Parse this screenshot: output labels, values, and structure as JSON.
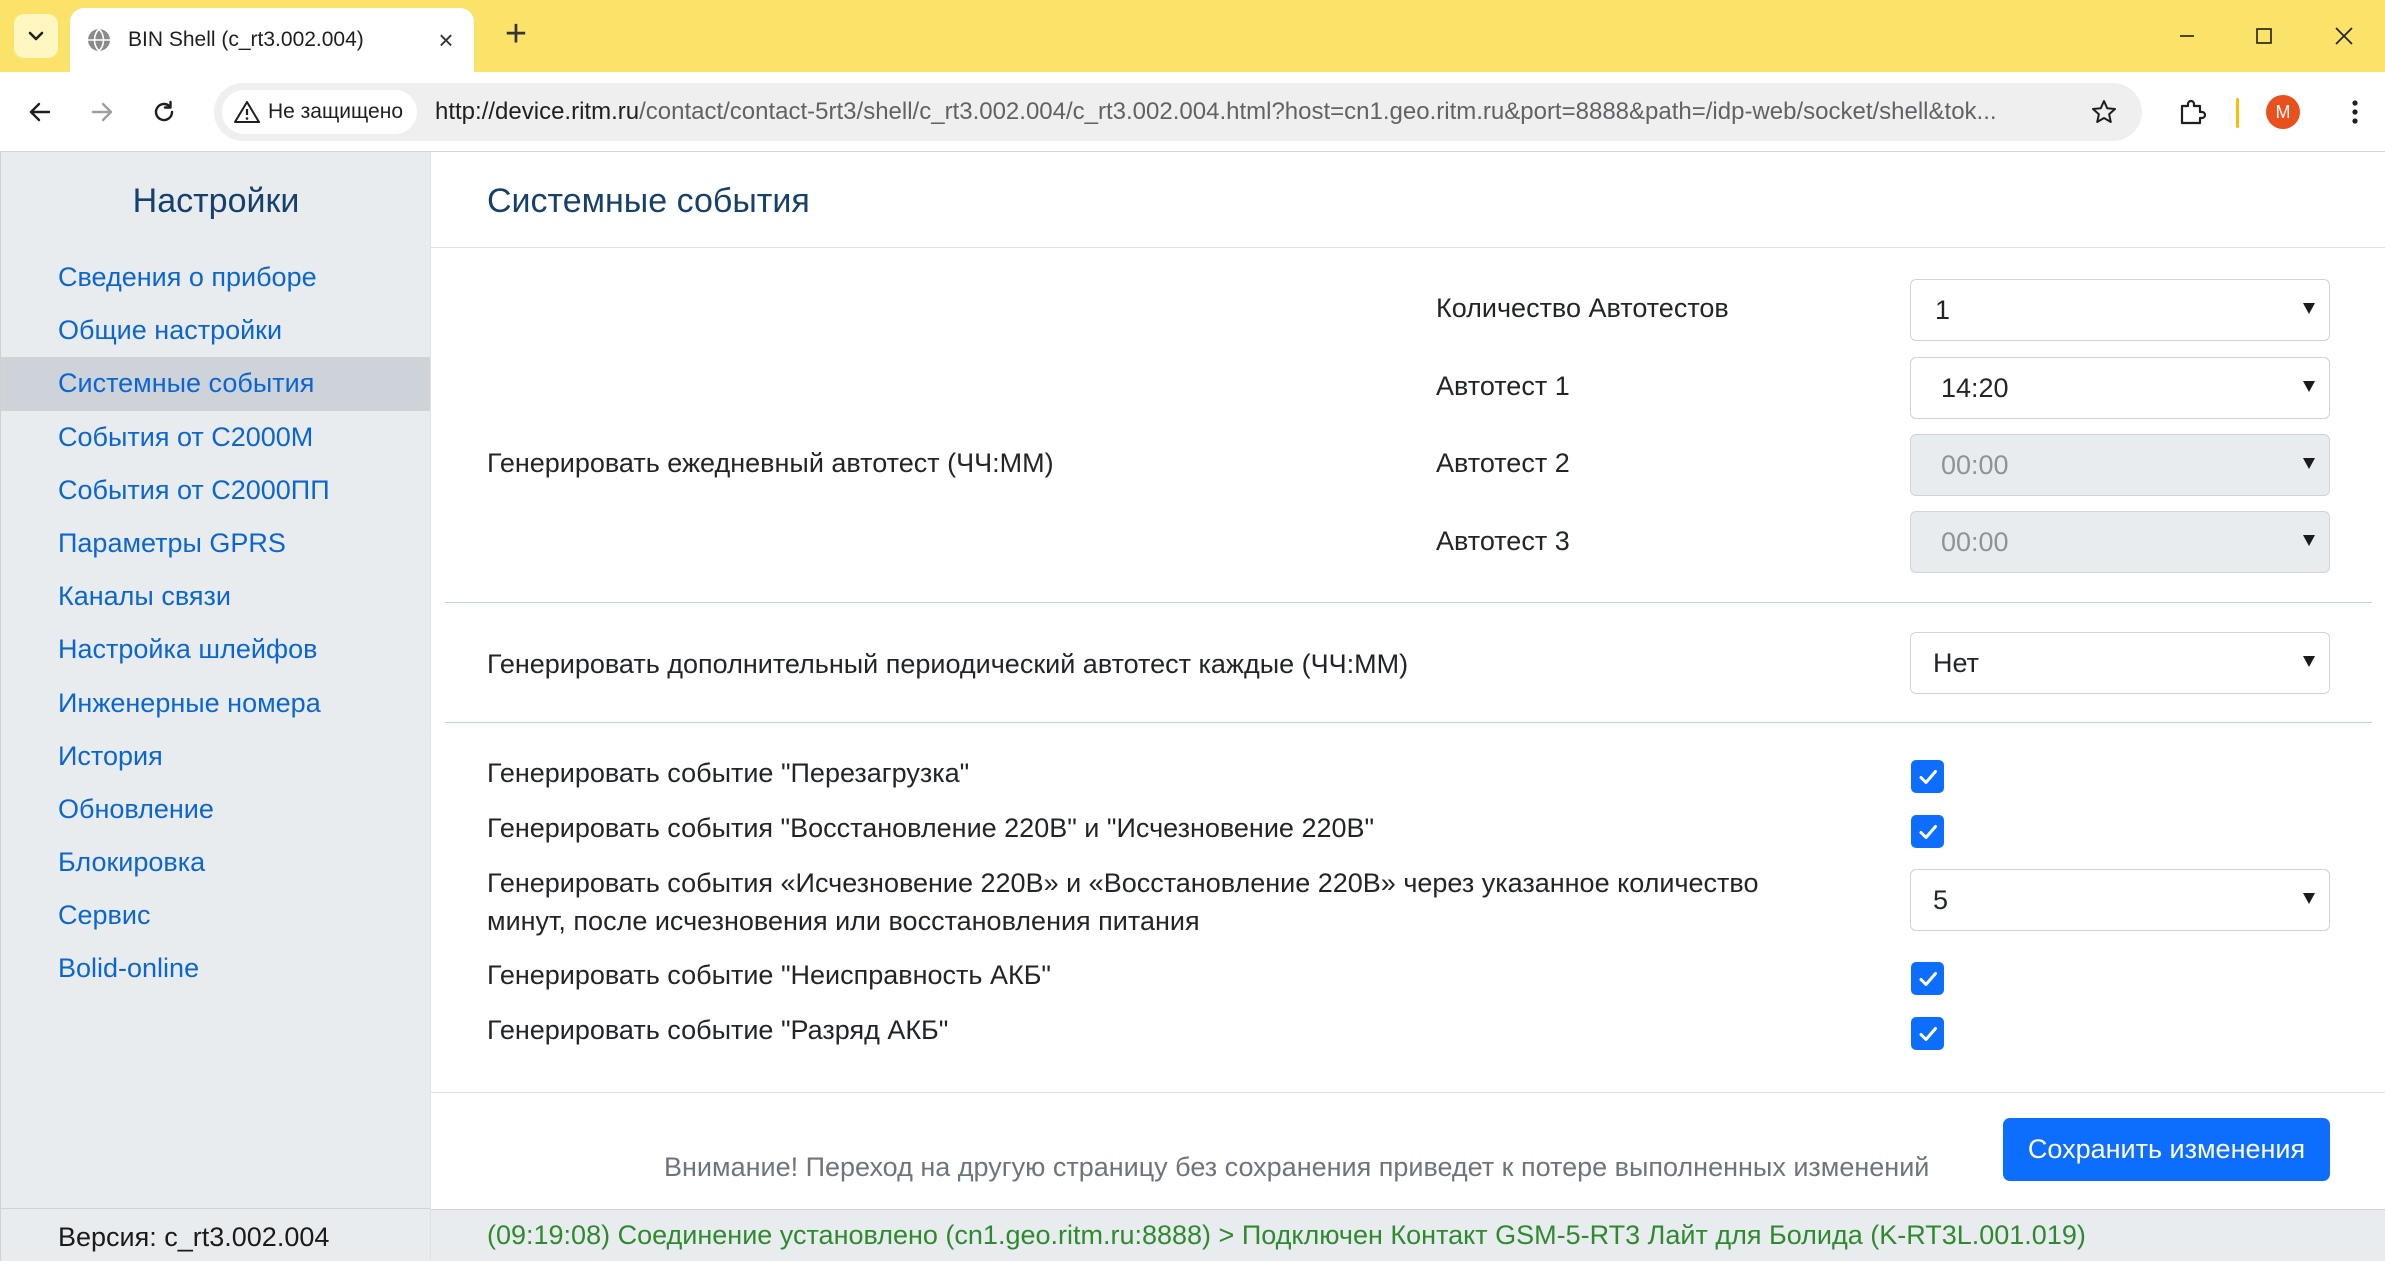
{
  "browser": {
    "tab_title": "BIN Shell (c_rt3.002.004)",
    "security_label": "Не защищено",
    "url_host": "http://device.ritm.ru",
    "url_rest": "/contact/contact-5rt3/shell/c_rt3.002.004/c_rt3.002.004.html?host=cn1.geo.ritm.ru&port=8888&path=/idp-web/socket/shell&tok...",
    "profile_initial": "M",
    "accent_color": "#fbe36a"
  },
  "sidebar": {
    "title": "Настройки",
    "items": [
      {
        "label": "Сведения о приборе"
      },
      {
        "label": "Общие настройки"
      },
      {
        "label": "Системные события",
        "active": true
      },
      {
        "label": "События от С2000М"
      },
      {
        "label": "События от С2000ПП"
      },
      {
        "label": "Параметры GPRS"
      },
      {
        "label": "Каналы связи"
      },
      {
        "label": "Настройка шлейфов"
      },
      {
        "label": "Инженерные номера"
      },
      {
        "label": "История"
      },
      {
        "label": "Обновление"
      },
      {
        "label": "Блокировка"
      },
      {
        "label": "Сервис"
      },
      {
        "label": "Bolid-online"
      }
    ],
    "version": "Версия: c_rt3.002.004"
  },
  "main": {
    "title": "Системные события",
    "daily_autotest": {
      "label": "Генерировать ежедневный автотест (ЧЧ:ММ)",
      "count_label": "Количество Автотестов",
      "count_value": "1",
      "test1_label": "Автотест 1",
      "test1_value": "14:20",
      "test2_label": "Автотест 2",
      "test2_value": "00:00",
      "test3_label": "Автотест 3",
      "test3_value": "00:00"
    },
    "periodic": {
      "label": "Генерировать дополнительный периодический автотест каждые (ЧЧ:ММ)",
      "value": "Нет"
    },
    "events": {
      "reboot_label": "Генерировать событие \"Перезагрузка\"",
      "reboot_checked": true,
      "power_label": "Генерировать события \"Восстановление 220В\" и \"Исчезновение 220В\"",
      "power_checked": true,
      "delay_label_line1": "Генерировать события «Исчезновение 220В» и «Восстановление 220В» через указанное количество",
      "delay_label_line2": "минут, после исчезновения или восстановления питания",
      "delay_value": "5",
      "battery_fault_label": "Генерировать событие \"Неисправность АКБ\"",
      "battery_fault_checked": true,
      "battery_low_label": "Генерировать событие \"Разряд АКБ\"",
      "battery_low_checked": true
    },
    "warning": "Внимание! Переход на другую страницу без сохранения приведет к потере выполненных изменений",
    "save_label": "Сохранить изменения",
    "status": "(09:19:08) Соединение установлено (cn1.geo.ritm.ru:8888) > Подключен Контакт GSM-5-RT3 Лайт для Болида (K-RT3L.001.019)"
  }
}
